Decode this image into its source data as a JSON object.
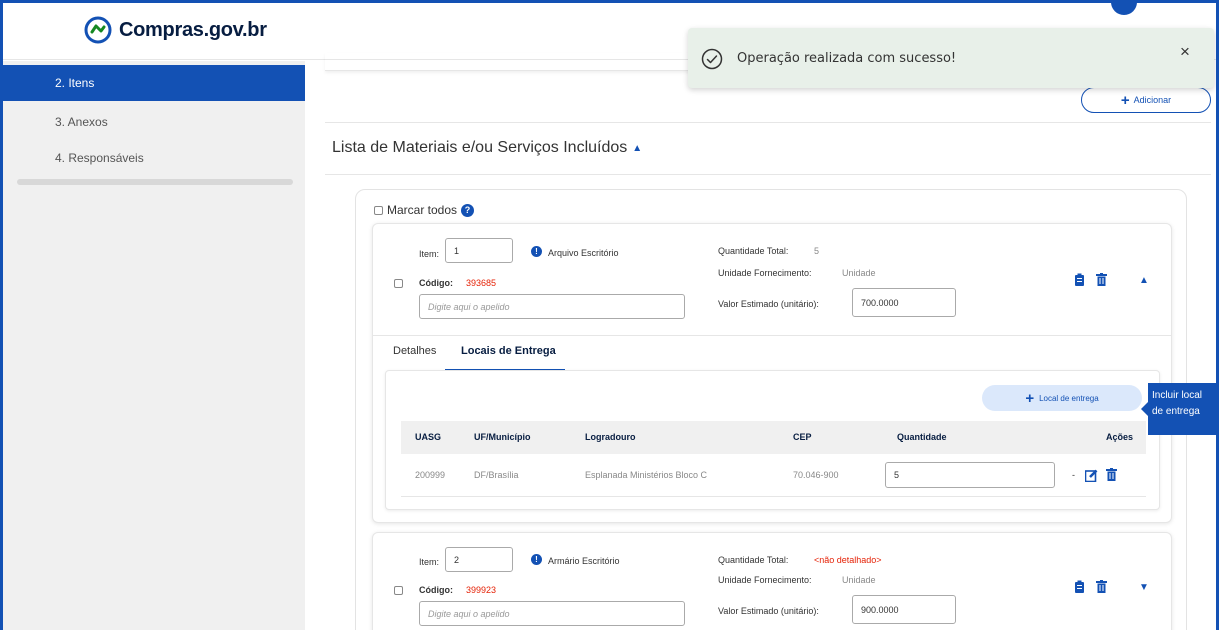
{
  "header": {
    "logo_text": "Compras.gov.br"
  },
  "sidebar": {
    "items": [
      {
        "label": "2. Itens",
        "active": true
      },
      {
        "label": "3. Anexos",
        "active": false
      },
      {
        "label": "4. Responsáveis",
        "active": false
      }
    ]
  },
  "main": {
    "add_button_label": "Adicionar",
    "section_title": "Lista de Materiais e/ou Serviços Incluídos",
    "select_all_label": "Marcar todos",
    "items": [
      {
        "item_label": "Item:",
        "item_number": "1",
        "description": "Arquivo Escritório",
        "codigo_label": "Código:",
        "codigo_value": "393685",
        "apelido_placeholder": "Digite aqui o apelido",
        "quantidade_label": "Quantidade Total:",
        "quantidade_value": "5",
        "unidade_label": "Unidade Fornecimento:",
        "unidade_value": "Unidade",
        "valor_label": "Valor Estimado (unitário):",
        "valor_value": "700.0000",
        "expanded": true
      },
      {
        "item_label": "Item:",
        "item_number": "2",
        "description": "Armário Escritório",
        "codigo_label": "Código:",
        "codigo_value": "399923",
        "apelido_placeholder": "Digite aqui o apelido",
        "quantidade_label": "Quantidade Total:",
        "quantidade_value": "<não detalhado>",
        "unidade_label": "Unidade Fornecimento:",
        "unidade_value": "Unidade",
        "valor_label": "Valor Estimado (unitário):",
        "valor_value": "900.0000",
        "expanded": false
      }
    ],
    "tabs": [
      {
        "label": "Detalhes",
        "active": false
      },
      {
        "label": "Locais de Entrega",
        "active": true
      }
    ],
    "local_button_label": "Local de entrega",
    "table": {
      "headers": [
        "UASG",
        "UF/Município",
        "Logradouro",
        "CEP",
        "Quantidade",
        "Ações"
      ],
      "rows": [
        {
          "uasg": "200999",
          "uf": "DF/Brasília",
          "logradouro": "Esplanada Ministérios Bloco C",
          "cep": "70.046-900",
          "quantidade": "5",
          "dash": "-"
        }
      ]
    }
  },
  "toast": {
    "message": "Operação realizada com sucesso!",
    "close": "×"
  },
  "tooltip": {
    "line1": "Incluir local",
    "line2": "de entrega"
  },
  "colors": {
    "primary": "#1351b4",
    "sidebar_bg": "#f0f0f0",
    "toast_bg": "#e8f0e9",
    "code_red": "#e52207"
  }
}
